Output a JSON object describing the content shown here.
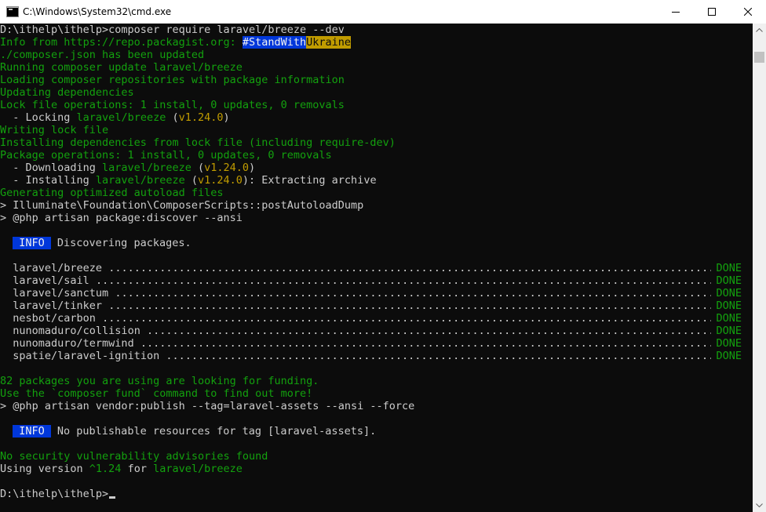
{
  "window": {
    "title": "C:\\Windows\\System32\\cmd.exe",
    "icon": "cmd-icon",
    "controls": [
      "minimize-icon",
      "maximize-icon",
      "close-icon"
    ]
  },
  "colors": {
    "background": "#0c0c0c",
    "text": "#cccccc",
    "green": "#13a10e",
    "yellow": "#c19c00",
    "badge_blue": "#0037da"
  },
  "terminal": {
    "lines": [
      {
        "type": "segs",
        "segs": [
          {
            "c": "w",
            "t": "D:\\ithelp\\ithelp>composer require laravel/breeze --dev"
          }
        ]
      },
      {
        "type": "segs",
        "segs": [
          {
            "c": "g",
            "t": "Info from https://repo.packagist.org: "
          },
          {
            "c": "hl-blue",
            "t": "#StandWith"
          },
          {
            "c": "hl-yellow",
            "t": "Ukraine"
          }
        ]
      },
      {
        "type": "segs",
        "segs": [
          {
            "c": "g",
            "t": "./composer.json has been updated"
          }
        ]
      },
      {
        "type": "segs",
        "segs": [
          {
            "c": "g",
            "t": "Running composer update laravel/breeze"
          }
        ]
      },
      {
        "type": "segs",
        "segs": [
          {
            "c": "g",
            "t": "Loading composer repositories with package information"
          }
        ]
      },
      {
        "type": "segs",
        "segs": [
          {
            "c": "g",
            "t": "Updating dependencies"
          }
        ]
      },
      {
        "type": "segs",
        "segs": [
          {
            "c": "g",
            "t": "Lock file operations: 1 install, 0 updates, 0 removals"
          }
        ]
      },
      {
        "type": "segs",
        "segs": [
          {
            "c": "w",
            "t": "  - Locking "
          },
          {
            "c": "g",
            "t": "laravel/breeze"
          },
          {
            "c": "w",
            "t": " ("
          },
          {
            "c": "y",
            "t": "v1.24.0"
          },
          {
            "c": "w",
            "t": ")"
          }
        ]
      },
      {
        "type": "segs",
        "segs": [
          {
            "c": "g",
            "t": "Writing lock file"
          }
        ]
      },
      {
        "type": "segs",
        "segs": [
          {
            "c": "g",
            "t": "Installing dependencies from lock file (including require-dev)"
          }
        ]
      },
      {
        "type": "segs",
        "segs": [
          {
            "c": "g",
            "t": "Package operations: 1 install, 0 updates, 0 removals"
          }
        ]
      },
      {
        "type": "segs",
        "segs": [
          {
            "c": "w",
            "t": "  - Downloading "
          },
          {
            "c": "g",
            "t": "laravel/breeze"
          },
          {
            "c": "w",
            "t": " ("
          },
          {
            "c": "y",
            "t": "v1.24.0"
          },
          {
            "c": "w",
            "t": ")"
          }
        ]
      },
      {
        "type": "segs",
        "segs": [
          {
            "c": "w",
            "t": "  - Installing "
          },
          {
            "c": "g",
            "t": "laravel/breeze"
          },
          {
            "c": "w",
            "t": " ("
          },
          {
            "c": "y",
            "t": "v1.24.0"
          },
          {
            "c": "w",
            "t": "): Extracting archive"
          }
        ]
      },
      {
        "type": "segs",
        "segs": [
          {
            "c": "g",
            "t": "Generating optimized autoload files"
          }
        ]
      },
      {
        "type": "segs",
        "segs": [
          {
            "c": "w",
            "t": "> Illuminate\\Foundation\\ComposerScripts::postAutoloadDump"
          }
        ]
      },
      {
        "type": "segs",
        "segs": [
          {
            "c": "w",
            "t": "> @php artisan package:discover --ansi"
          }
        ]
      },
      {
        "type": "blank"
      },
      {
        "type": "segs",
        "segs": [
          {
            "c": "w",
            "t": "  "
          },
          {
            "c": "badge",
            "t": "INFO"
          },
          {
            "c": "w",
            "t": " Discovering packages."
          }
        ]
      },
      {
        "type": "blank"
      },
      {
        "type": "pkg",
        "name": "laravel/breeze",
        "status": "DONE"
      },
      {
        "type": "pkg",
        "name": "laravel/sail",
        "status": "DONE"
      },
      {
        "type": "pkg",
        "name": "laravel/sanctum",
        "status": "DONE"
      },
      {
        "type": "pkg",
        "name": "laravel/tinker",
        "status": "DONE"
      },
      {
        "type": "pkg",
        "name": "nesbot/carbon",
        "status": "DONE"
      },
      {
        "type": "pkg",
        "name": "nunomaduro/collision",
        "status": "DONE"
      },
      {
        "type": "pkg",
        "name": "nunomaduro/termwind",
        "status": "DONE"
      },
      {
        "type": "pkg",
        "name": "spatie/laravel-ignition",
        "status": "DONE"
      },
      {
        "type": "blank"
      },
      {
        "type": "segs",
        "segs": [
          {
            "c": "g",
            "t": "82 packages you are using are looking for funding."
          }
        ]
      },
      {
        "type": "segs",
        "segs": [
          {
            "c": "g",
            "t": "Use the `composer fund` command to find out more!"
          }
        ]
      },
      {
        "type": "segs",
        "segs": [
          {
            "c": "w",
            "t": "> @php artisan vendor:publish --tag=laravel-assets --ansi --force"
          }
        ]
      },
      {
        "type": "blank"
      },
      {
        "type": "segs",
        "segs": [
          {
            "c": "w",
            "t": "  "
          },
          {
            "c": "badge",
            "t": "INFO"
          },
          {
            "c": "w",
            "t": " No publishable resources for tag [laravel-assets]."
          }
        ]
      },
      {
        "type": "blank"
      },
      {
        "type": "segs",
        "segs": [
          {
            "c": "g",
            "t": "No security vulnerability advisories found"
          }
        ]
      },
      {
        "type": "segs",
        "segs": [
          {
            "c": "w",
            "t": "Using version "
          },
          {
            "c": "g",
            "t": "^1.24"
          },
          {
            "c": "w",
            "t": " for "
          },
          {
            "c": "g",
            "t": "laravel/breeze"
          }
        ]
      },
      {
        "type": "blank"
      },
      {
        "type": "prompt",
        "text": "D:\\ithelp\\ithelp>"
      }
    ]
  }
}
